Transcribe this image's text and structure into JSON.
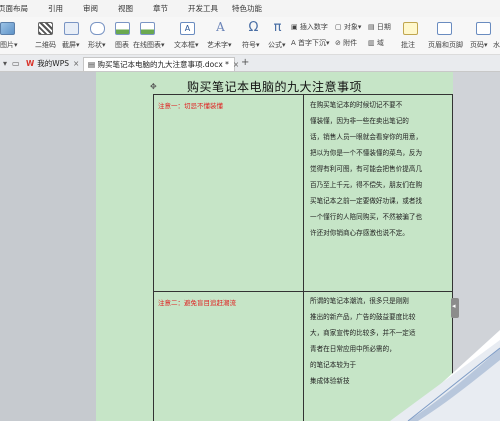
{
  "menu": [
    "页面布局",
    "引用",
    "审阅",
    "视图",
    "章节",
    "开发工具",
    "特色功能"
  ],
  "ribbon": {
    "picture": "图片",
    "qrcode": "二维码",
    "screenshot": "截屏",
    "shape": "形状",
    "chart": "图表",
    "online_chart": "在线图表",
    "textbox": "文本框",
    "wordart": "艺术字",
    "symbol": "符号",
    "formula": "公式",
    "insert_number": "插入数字",
    "object": "对象",
    "date": "日期",
    "dropcap": "首字下沉",
    "attachment": "附件",
    "domain": "域",
    "comment": "批注",
    "header_footer": "页眉和页脚",
    "page_number": "页码",
    "watermark": "水"
  },
  "tabs": {
    "wps": "我的WPS",
    "doc": "购买笔记本电脑的九大注意事项.docx *"
  },
  "document": {
    "title": "购买笔记本电脑的九大注意事项",
    "caution1": "注意一：切忌不懂装懂",
    "body1": [
      "在购买笔记本的时候切记不要不",
      "懂装懂，因为非一些在卖出笔记的",
      "话，销售人员一眼就会看穿你的用意，",
      "把以为你是一个不懂装懂的菜鸟，反为",
      "觉得有利可图，有可能会把售价提高几",
      "百乃至上千元，得不偿失，朋友们在购",
      "买笔记本之前一定要做好功课，或者找",
      "一个懂行的人陪同购买，不然被骗了也",
      "许还对你销商心存感激也说不定。"
    ],
    "caution2": "注意二：避免盲目追赶潮流",
    "body2": [
      "所谓的笔记本潮流，很多只是刚刚",
      "推出的新产品，广告的鼓益要度比较",
      "大，商家宣传的比较多，并不一定适",
      "青者在日常应用中所必需的，",
      "的笔记本较为于",
      "集成体验新技"
    ]
  }
}
